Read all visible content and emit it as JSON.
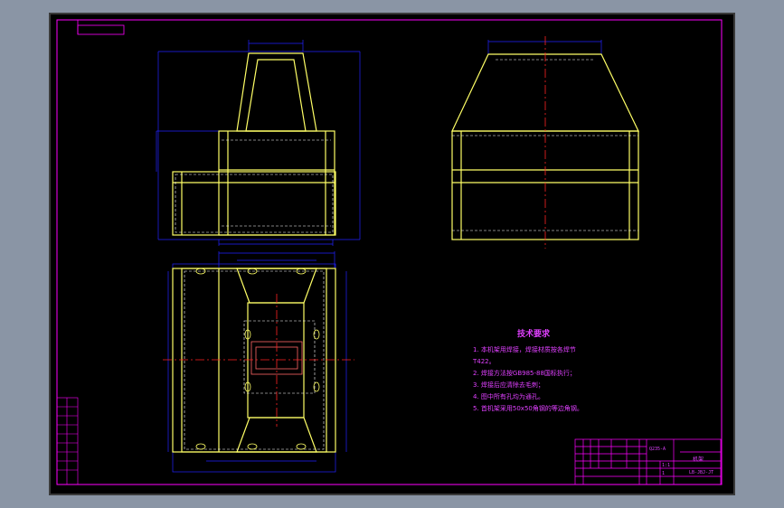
{
  "drawing": {
    "tech_title": "技术要求",
    "tech_requirements": [
      "1. 本机架用焊接，焊接材质按各焊节",
      "T422。",
      "2. 焊接方法按GB985-88国标执行；",
      "3. 焊接后应清除去毛刺；",
      "4. 图中所有孔均为通孔。",
      "5. 首机架采用50x50角钢的等边角钢。"
    ],
    "title_block": {
      "part_no": "Q235-A",
      "name": "机架",
      "drawing_no": "LB-JBJ-JT",
      "scale": "1:1",
      "quantity": "1"
    }
  },
  "colors": {
    "frame_outer": "#000000",
    "border": "#ff00ff",
    "outline": "#ffff66",
    "dimension": "#2222ff",
    "centerline": "#ff2222",
    "hidden": "#ffffff"
  }
}
